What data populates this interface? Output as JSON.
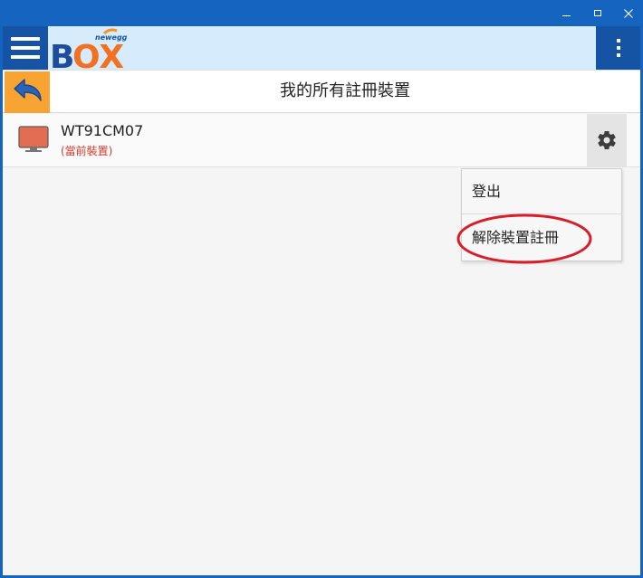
{
  "window": {
    "minimize_glyph": "—",
    "close_glyph": "✕",
    "chrome_color": "#1565c0"
  },
  "appbar": {
    "menu_icon": "hamburger-icon",
    "logo": {
      "small_text": "newegg",
      "main_text_blue": "B",
      "main_text_orange": "OX"
    },
    "overflow_icon": "kebab-icon",
    "accent_color": "#1554a5",
    "background": "#d6ebfb"
  },
  "header": {
    "back_icon": "back-arrow-icon",
    "back_color": "#f7a432",
    "title": "我的所有註冊裝置"
  },
  "device": {
    "icon": "monitor-icon",
    "name": "WT91CM07",
    "status": "(當前裝置)",
    "status_color": "#d03a2a",
    "settings_icon": "gear-icon"
  },
  "context_menu": {
    "items": [
      {
        "label": "登出"
      },
      {
        "label": "解除裝置註冊"
      }
    ],
    "highlight_color": "#d61f2b"
  }
}
